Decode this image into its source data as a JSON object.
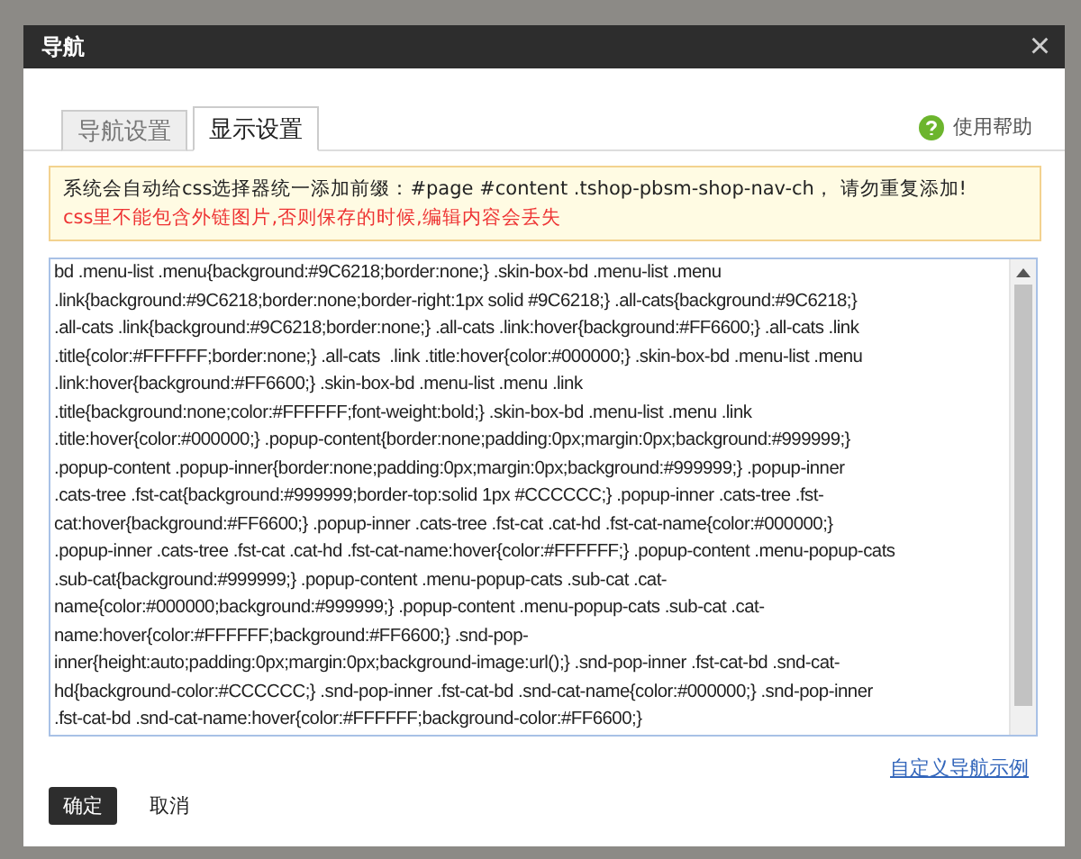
{
  "dialog": {
    "title": "导航",
    "close": "×"
  },
  "tabs": [
    {
      "label": "导航设置",
      "selected": false
    },
    {
      "label": "显示设置",
      "selected": true
    }
  ],
  "help": "使用帮助",
  "notice": {
    "line": "系统会自动给css选择器统一添加前缀：#page #content .tshop-pbsm-shop-nav-ch， 请勿重复添加!",
    "warning": "css里不能包含外链图片,否则保存的时候,编辑内容会丢失"
  },
  "css_editor": {
    "value": "bd .menu-list .menu{background:#9C6218;border:none;} .skin-box-bd .menu-list .menu\n.link{background:#9C6218;border:none;border-right:1px solid #9C6218;} .all-cats{background:#9C6218;}\n.all-cats .link{background:#9C6218;border:none;} .all-cats .link:hover{background:#FF6600;} .all-cats .link\n.title{color:#FFFFFF;border:none;} .all-cats  .link .title:hover{color:#000000;} .skin-box-bd .menu-list .menu\n.link:hover{background:#FF6600;} .skin-box-bd .menu-list .menu .link\n.title{background:none;color:#FFFFFF;font-weight:bold;} .skin-box-bd .menu-list .menu .link\n.title:hover{color:#000000;} .popup-content{border:none;padding:0px;margin:0px;background:#999999;}\n.popup-content .popup-inner{border:none;padding:0px;margin:0px;background:#999999;} .popup-inner\n.cats-tree .fst-cat{background:#999999;border-top:solid 1px #CCCCCC;} .popup-inner .cats-tree .fst-\ncat:hover{background:#FF6600;} .popup-inner .cats-tree .fst-cat .cat-hd .fst-cat-name{color:#000000;}\n.popup-inner .cats-tree .fst-cat .cat-hd .fst-cat-name:hover{color:#FFFFFF;} .popup-content .menu-popup-cats\n.sub-cat{background:#999999;} .popup-content .menu-popup-cats .sub-cat .cat-\nname{color:#000000;background:#999999;} .popup-content .menu-popup-cats .sub-cat .cat-\nname:hover{color:#FFFFFF;background:#FF6600;} .snd-pop-\ninner{height:auto;padding:0px;margin:0px;background-image:url();} .snd-pop-inner .fst-cat-bd .snd-cat-\nhd{background-color:#CCCCCC;} .snd-pop-inner .fst-cat-bd .snd-cat-name{color:#000000;} .snd-pop-inner\n.fst-cat-bd .snd-cat-name:hover{color:#FFFFFF;background-color:#FF6600;}"
  },
  "example_link": "自定义导航示例",
  "buttons": [
    {
      "label": "确定",
      "kind": "primary"
    },
    {
      "label": "取消",
      "kind": "plain"
    }
  ]
}
